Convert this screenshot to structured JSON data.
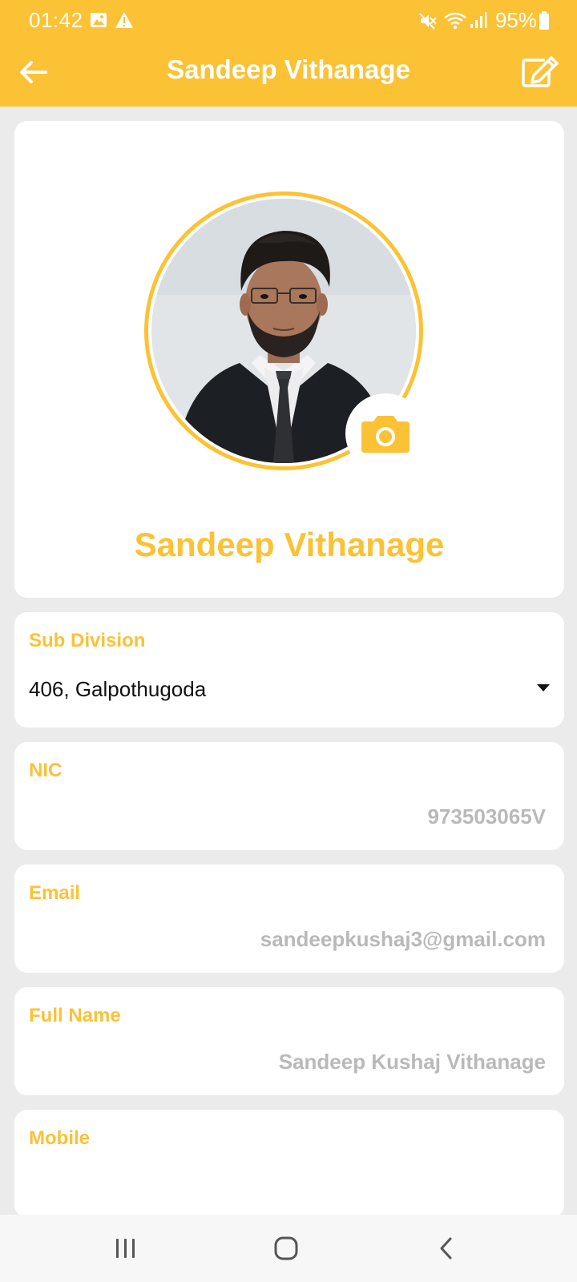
{
  "status_bar": {
    "time": "01:42",
    "battery": "95%",
    "icons": [
      "image-icon",
      "warning-icon",
      "mute-icon",
      "wifi-icon",
      "signal-icon",
      "battery-icon"
    ]
  },
  "app_bar": {
    "title": "Sandeep Vithanage",
    "back_icon": "arrow-left-icon",
    "edit_icon": "edit-icon"
  },
  "profile": {
    "name": "Sandeep Vithanage",
    "camera_icon": "camera-icon"
  },
  "fields": {
    "sub_division": {
      "label": "Sub Division",
      "value": "406, Galpothugoda"
    },
    "nic": {
      "label": "NIC",
      "value": "973503065V"
    },
    "email": {
      "label": "Email",
      "value": "sandeepkushaj3@gmail.com"
    },
    "full_name": {
      "label": "Full Name",
      "value": "Sandeep Kushaj Vithanage"
    },
    "mobile": {
      "label": "Mobile",
      "value": ""
    }
  },
  "colors": {
    "accent": "#FBC236",
    "background": "#EBEBEB",
    "card": "#FFFFFF",
    "muted_text": "#B9B9B9"
  },
  "nav_bar": {
    "icons": [
      "recents-icon",
      "home-icon",
      "back-nav-icon"
    ]
  }
}
